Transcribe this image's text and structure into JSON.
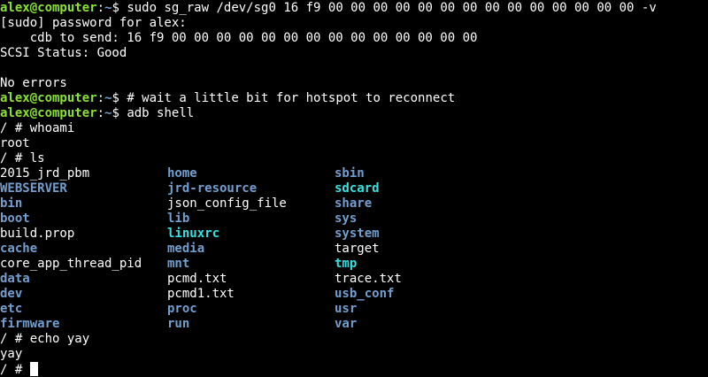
{
  "terminal": {
    "prompt_user": "alex@computer",
    "prompt_path": "~",
    "line1_cmd": " sudo sg_raw /dev/sg0 16 f9 00 00 00 00 00 00 00 00 00 00 00 00 00 00 -v",
    "line2": "[sudo] password for alex:",
    "line3": "    cdb to send: 16 f9 00 00 00 00 00 00 00 00 00 00 00 00 00 00",
    "line4": "SCSI Status: Good",
    "line5": "",
    "line6": "No errors",
    "line7_cmd": " # wait a little bit for hotspot to reconnect",
    "line8_cmd": " adb shell",
    "line9": "/ # whoami",
    "line10": "root",
    "line11": "/ # ls",
    "ls_rows": [
      [
        {
          "t": "2015_jrd_pbm",
          "k": "file"
        },
        {
          "t": "home",
          "k": "dir"
        },
        {
          "t": "sbin",
          "k": "dir"
        }
      ],
      [
        {
          "t": "WEBSERVER",
          "k": "dir"
        },
        {
          "t": "jrd-resource",
          "k": "dir"
        },
        {
          "t": "sdcard",
          "k": "link"
        }
      ],
      [
        {
          "t": "bin",
          "k": "dir"
        },
        {
          "t": "json_config_file",
          "k": "file"
        },
        {
          "t": "share",
          "k": "dir"
        }
      ],
      [
        {
          "t": "boot",
          "k": "dir"
        },
        {
          "t": "lib",
          "k": "dir"
        },
        {
          "t": "sys",
          "k": "dir"
        }
      ],
      [
        {
          "t": "build.prop",
          "k": "file"
        },
        {
          "t": "linuxrc",
          "k": "link"
        },
        {
          "t": "system",
          "k": "dir"
        }
      ],
      [
        {
          "t": "cache",
          "k": "dir"
        },
        {
          "t": "media",
          "k": "dir"
        },
        {
          "t": "target",
          "k": "file"
        }
      ],
      [
        {
          "t": "core_app_thread_pid",
          "k": "file"
        },
        {
          "t": "mnt",
          "k": "dir"
        },
        {
          "t": "tmp",
          "k": "link"
        }
      ],
      [
        {
          "t": "data",
          "k": "dir"
        },
        {
          "t": "pcmd.txt",
          "k": "file"
        },
        {
          "t": "trace.txt",
          "k": "file"
        }
      ],
      [
        {
          "t": "dev",
          "k": "dir"
        },
        {
          "t": "pcmd1.txt",
          "k": "file"
        },
        {
          "t": "usb_conf",
          "k": "dir"
        }
      ],
      [
        {
          "t": "etc",
          "k": "dir"
        },
        {
          "t": "proc",
          "k": "dir"
        },
        {
          "t": "usr",
          "k": "dir"
        }
      ],
      [
        {
          "t": "firmware",
          "k": "dir"
        },
        {
          "t": "run",
          "k": "dir"
        },
        {
          "t": "var",
          "k": "dir"
        }
      ]
    ],
    "line_echo": "/ # echo yay",
    "line_yay": "yay",
    "line_last": "/ # "
  },
  "colors": {
    "background": "#000000",
    "text": "#ffffff",
    "prompt_user": "#8ae234",
    "prompt_path": "#729fcf",
    "directory": "#729fcf",
    "symlink": "#34e2e2"
  }
}
